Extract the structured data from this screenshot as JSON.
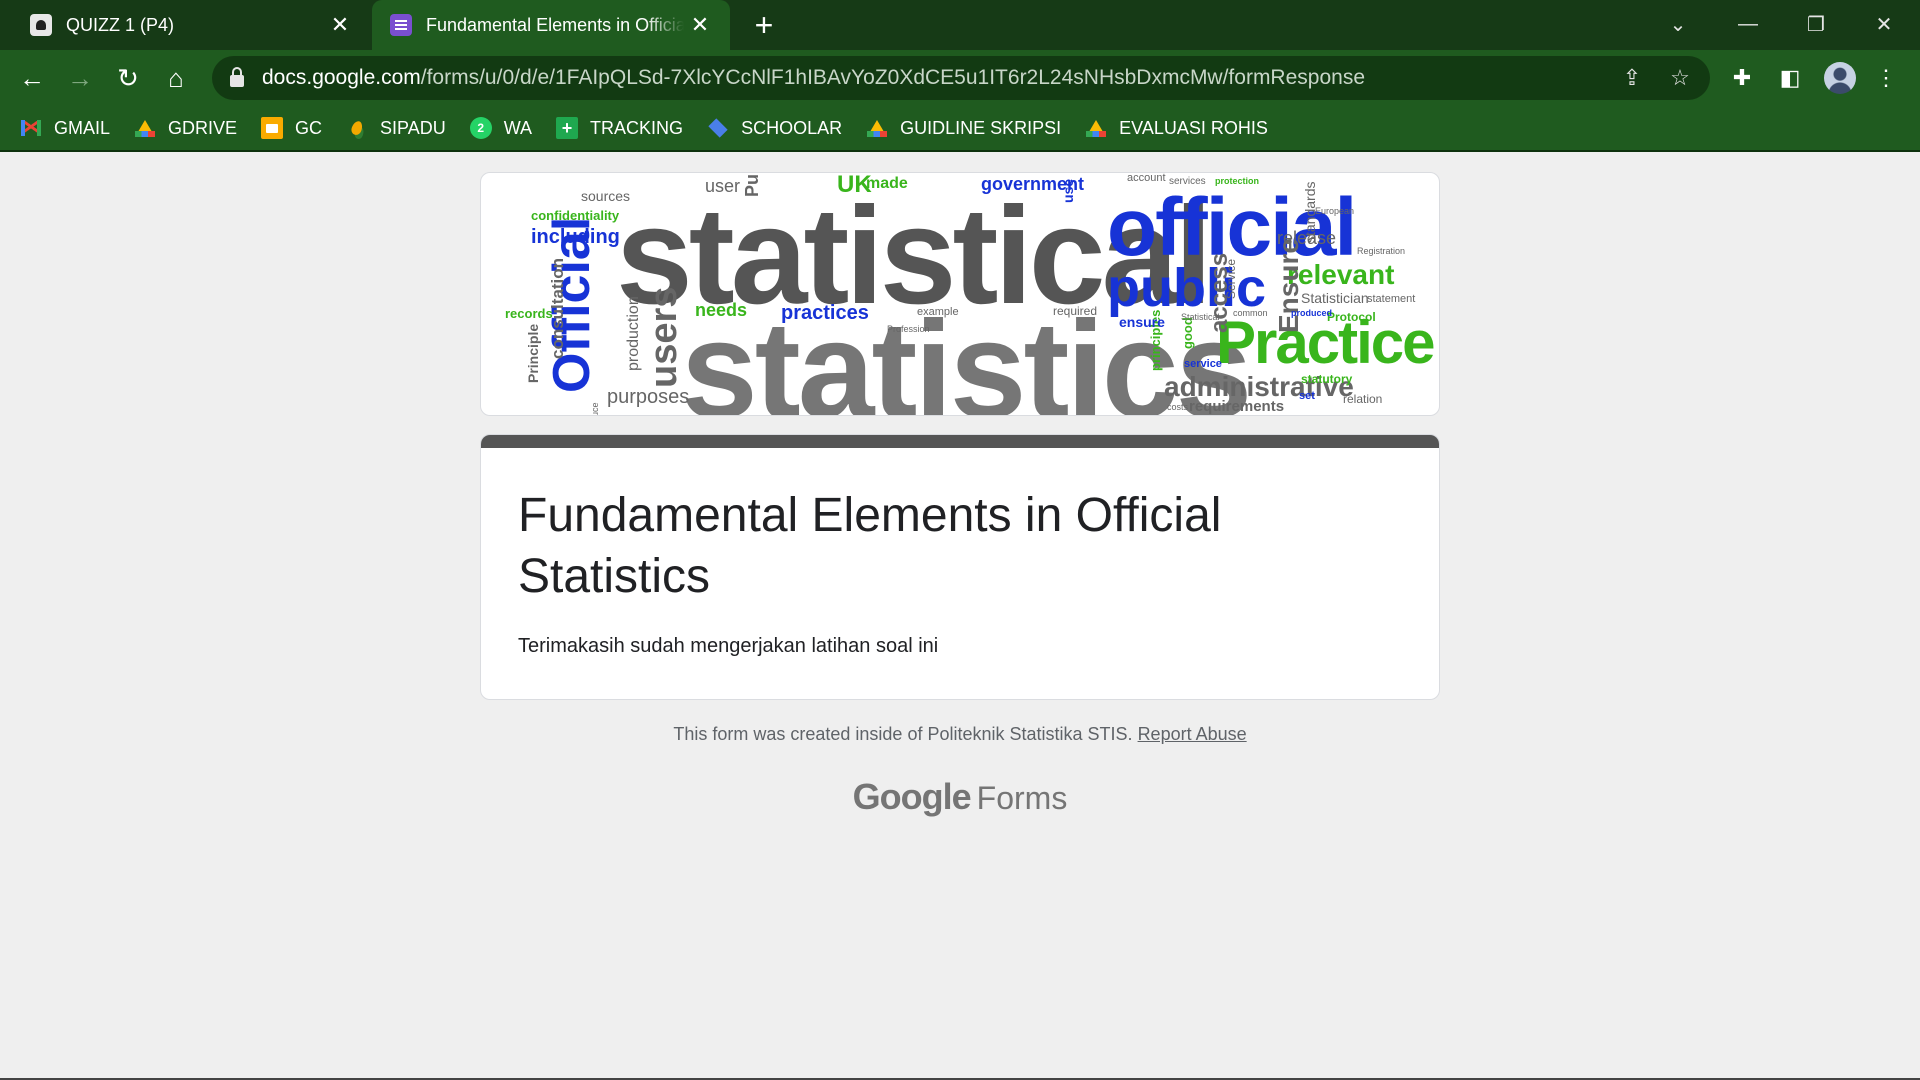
{
  "browser": {
    "tabs": [
      {
        "title": "QUIZZ 1 (P4)",
        "active": false,
        "icon": "classroom-icon"
      },
      {
        "title": "Fundamental Elements in Official Statistics",
        "active": true,
        "icon": "forms-icon"
      }
    ],
    "new_tab_icon": "+",
    "url_host": "docs.google.com",
    "url_path": "/forms/u/0/d/e/1FAIpQLSd-7XlcYCcNlF1hIBAvYoZ0XdCE5u1IT6r2L24sNHsbDxmcMw/formResponse",
    "bookmarks": [
      {
        "label": "GMAIL",
        "icon": "gmail-icon"
      },
      {
        "label": "GDRIVE",
        "icon": "drive-icon"
      },
      {
        "label": "GC",
        "icon": "classroom-icon"
      },
      {
        "label": "SIPADU",
        "icon": "sipadu-icon"
      },
      {
        "label": "WA",
        "icon": "whatsapp-icon",
        "badge": "2"
      },
      {
        "label": "TRACKING",
        "icon": "tracking-icon",
        "badge": "+"
      },
      {
        "label": "SCHOOLAR",
        "icon": "schoolar-icon"
      },
      {
        "label": "GUIDLINE SKRIPSI",
        "icon": "drive-icon"
      },
      {
        "label": "EVALUASI ROHIS",
        "icon": "drive-icon"
      }
    ]
  },
  "banner": {
    "words": [
      {
        "text": "statistical",
        "color": "#555555"
      },
      {
        "text": "statistics",
        "color": "#555555"
      },
      {
        "text": "official",
        "color": "#1733d6"
      },
      {
        "text": "public",
        "color": "#1733d6"
      },
      {
        "text": "Practice",
        "color": "#39b51c"
      },
      {
        "text": "Official",
        "color": "#1733d6"
      },
      {
        "text": "administrative",
        "color": "#666666"
      },
      {
        "text": "users",
        "color": "#666666"
      },
      {
        "text": "practices",
        "color": "#1733d6"
      },
      {
        "text": "relevant",
        "color": "#39b51c"
      },
      {
        "text": "Ensure",
        "color": "#666666"
      },
      {
        "text": "access",
        "color": "#666666"
      },
      {
        "text": "government",
        "color": "#1733d6"
      },
      {
        "text": "UK",
        "color": "#39b51c"
      },
      {
        "text": "made",
        "color": "#39b51c"
      },
      {
        "text": "confidentiality",
        "color": "#39b51c"
      },
      {
        "text": "including",
        "color": "#1733d6"
      },
      {
        "text": "sources",
        "color": "#666666"
      },
      {
        "text": "consultation",
        "color": "#666666"
      },
      {
        "text": "production",
        "color": "#666666"
      },
      {
        "text": "Principle",
        "color": "#666666"
      },
      {
        "text": "records",
        "color": "#39b51c"
      },
      {
        "text": "purposes",
        "color": "#666666"
      },
      {
        "text": "needs",
        "color": "#39b51c"
      },
      {
        "text": "release",
        "color": "#666666"
      },
      {
        "text": "standards",
        "color": "#666666"
      },
      {
        "text": "Statistician",
        "color": "#666666"
      },
      {
        "text": "statement",
        "color": "#666666"
      },
      {
        "text": "Protocol",
        "color": "#39b51c"
      },
      {
        "text": "Registration",
        "color": "#666666"
      },
      {
        "text": "statutory",
        "color": "#39b51c"
      },
      {
        "text": "relation",
        "color": "#666666"
      },
      {
        "text": "requirements",
        "color": "#666666"
      },
      {
        "text": "principles",
        "color": "#39b51c"
      },
      {
        "text": "good",
        "color": "#39b51c"
      },
      {
        "text": "service",
        "color": "#1733d6"
      },
      {
        "text": "ensure",
        "color": "#1733d6"
      },
      {
        "text": "required",
        "color": "#666666"
      },
      {
        "text": "example",
        "color": "#666666"
      },
      {
        "text": "user",
        "color": "#666666"
      },
      {
        "text": "account",
        "color": "#666666"
      },
      {
        "text": "services",
        "color": "#666666"
      },
      {
        "text": "set",
        "color": "#1733d6"
      },
      {
        "text": "Service",
        "color": "#666666"
      },
      {
        "text": "use",
        "color": "#1733d6"
      },
      {
        "text": "produced",
        "color": "#1733d6"
      },
      {
        "text": "common",
        "color": "#666666"
      },
      {
        "text": "costs",
        "color": "#666666"
      },
      {
        "text": "Statistical",
        "color": "#666666"
      },
      {
        "text": "Pu",
        "color": "#666666"
      },
      {
        "text": "uce",
        "color": "#666666"
      },
      {
        "text": "Profession",
        "color": "#666666"
      },
      {
        "text": "protection",
        "color": "#39b51c"
      },
      {
        "text": "European",
        "color": "#666666"
      }
    ]
  },
  "form": {
    "title": "Fundamental Elements in Official Statistics",
    "confirmation_message": "Terimakasih sudah mengerjakan latihan soal ini",
    "footer_text": "This form was created inside of Politeknik Statistika STIS.",
    "report_abuse_label": "Report Abuse",
    "logo_google": "Google",
    "logo_forms": "Forms"
  },
  "colors": {
    "theme_bar": "#555555",
    "browser_frame": "#1f5b1f",
    "page_background": "#efefef"
  }
}
